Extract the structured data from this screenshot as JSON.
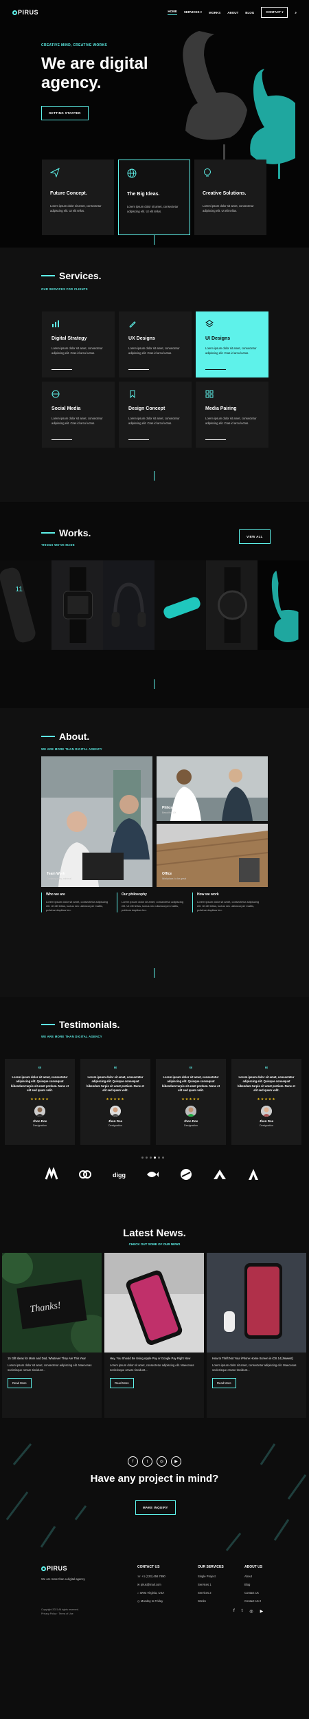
{
  "header": {
    "logo": "PIRUS",
    "nav": [
      "HOME",
      "SERVICES",
      "WORKS",
      "ABOUT",
      "BLOG"
    ],
    "contact": "CONTACT"
  },
  "hero": {
    "subtitle": "CREATIVE MIND, CREATIVE WORKS",
    "title_line1": "We are digital",
    "title_line2": "agency.",
    "cta": "GETTING STARTED",
    "cards": [
      {
        "title": "Future Concept.",
        "text": "Lorem ipsum dolor sit amet, consectetur adipiscing elit. Ut elit tellus."
      },
      {
        "title": "The Big Ideas.",
        "text": "Lorem ipsum dolor sit amet, consectetur adipiscing elit. Ut elit tellus."
      },
      {
        "title": "Creative Solutions.",
        "text": "Lorem ipsum dolor sit amet, consectetur adipiscing elit. Ut elit tellus."
      }
    ]
  },
  "services": {
    "title": "Services.",
    "subtitle": "OUR SERVICES FOR CLIENTS",
    "items": [
      {
        "title": "Digital Strategy",
        "text": "Lorem ipsum dolor sit amet, consectetur adipiscing elit. Cras id arcu luctus."
      },
      {
        "title": "UX Designs",
        "text": "Lorem ipsum dolor sit amet, consectetur adipiscing elit. Cras id arcu luctus."
      },
      {
        "title": "UI Designs",
        "text": "Lorem ipsum dolor sit amet, consectetur adipiscing elit. Cras id arcu luctus."
      },
      {
        "title": "Social Media",
        "text": "Lorem ipsum dolor sit amet, consectetur adipiscing elit. Cras id arcu luctus."
      },
      {
        "title": "Design Concept",
        "text": "Lorem ipsum dolor sit amet, consectetur adipiscing elit. Cras id arcu luctus."
      },
      {
        "title": "Media Pairing",
        "text": "Lorem ipsum dolor sit amet, consectetur adipiscing elit. Cras id arcu luctus."
      }
    ]
  },
  "works": {
    "title": "Works.",
    "subtitle": "THINGS WE'VE MADE",
    "view_all": "VIEW ALL"
  },
  "about": {
    "title": "About.",
    "subtitle": "WE ARE MORE THAN DIGITAL AGENCY",
    "images": [
      {
        "label": "Team Work",
        "caption": "Contemporary, minimal"
      },
      {
        "label": "Philosophy",
        "caption": "Beautiful, UX"
      },
      {
        "label": "Office",
        "caption": "Workplace, to be great"
      }
    ],
    "cols": [
      {
        "title": "Who we are",
        "text": "Lorem ipsum dolor sit amet, consectetur adipiscing elit. Ut elit tellus, luctus nec ullamcorper mattis, pulvinar dapibus leo."
      },
      {
        "title": "Our philosophy",
        "text": "Lorem ipsum dolor sit amet, consectetur adipiscing elit. Ut elit tellus, luctus nec ullamcorper mattis, pulvinar dapibus leo."
      },
      {
        "title": "How we work",
        "text": "Lorem ipsum dolor sit amet, consectetur adipiscing elit. Ut elit tellus, luctus nec ullamcorper mattis, pulvinar dapibus leo."
      }
    ]
  },
  "testimonials": {
    "title": "Testimonials.",
    "subtitle": "WE ARE MORE THAN DIGITAL AGENCY",
    "items": [
      {
        "text": "Lorem ipsum dolor sit amet, consectetur adipiscing elit. Quisque consequat bibendum turpis sit amet pretium. Nunc et elit sed quam velit.",
        "name": "Jhon Doe",
        "role": "Designation"
      },
      {
        "text": "Lorem ipsum dolor sit amet, consectetur adipiscing elit. Quisque consequat bibendum turpis sit amet pretium. Nunc et elit sed quam velit.",
        "name": "Jhon Doe",
        "role": "Designation"
      },
      {
        "text": "Lorem ipsum dolor sit amet, consectetur adipiscing elit. Quisque consequat bibendum turpis sit amet pretium. Nunc et elit sed quam velit.",
        "name": "Jhon Doe",
        "role": "Designation"
      },
      {
        "text": "Lorem ipsum dolor sit amet, consectetur adipiscing elit. Quisque consequat bibendum turpis sit amet pretium. Nunc et elit sed quam velit.",
        "name": "Jhon Doe",
        "role": "Designation"
      }
    ]
  },
  "news": {
    "title": "Latest News.",
    "subtitle": "CHECK OUT SOME OF OUR NEWS",
    "read_more": "Read More",
    "items": [
      {
        "title": "15 Gift Ideas for Mom and Dad, Whatever They Are This Year",
        "text": "Lorem ipsum dolor sit amet, consectetur adipiscing elit. Maecenas scelerisque ornare tincidunt..."
      },
      {
        "title": "Hey, You Should Be Using Apple Pay or Google Pay Right Now",
        "text": "Lorem ipsum dolor sit amet, consectetur adipiscing elit. Maecenas scelerisque ornare tincidunt..."
      },
      {
        "title": "How to Thrift Not Your iPhone Home Screen in iOS 14 [Newest]",
        "text": "Lorem ipsum dolor sit amet, consectetur adipiscing elit. Maecenas scelerisque ornare tincidunt..."
      }
    ]
  },
  "cta": {
    "title": "Have any project in mind?",
    "button": "MAKE INQUIRY"
  },
  "footer": {
    "logo": "PIRUS",
    "tagline": "We are more than a digital agency",
    "contact_title": "CONTACT US",
    "contact": [
      "+1 (123) 456 7890",
      "pirus@mail.com",
      "West Virginia, USA",
      "Monday to Friday"
    ],
    "services_title": "OUR SERVICES",
    "services": [
      "Single Project",
      "Services 1",
      "Services 2",
      "Works"
    ],
    "about_title": "ABOUT US",
    "about": [
      "About",
      "Blog",
      "Contact Us",
      "Contact Us 2"
    ],
    "copyright": "Copyright 2021 All rights reserved.",
    "links": "Privacy Policy · Terms of Use"
  },
  "colors": {
    "accent": "#5ef2ea",
    "bg": "#0d0d0d",
    "card": "#1a1a1a",
    "star": "#f5c518"
  }
}
